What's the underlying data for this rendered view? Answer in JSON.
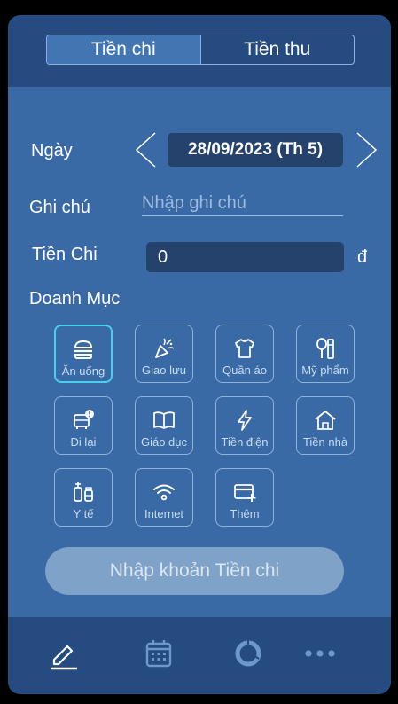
{
  "tabs": [
    {
      "label": "Tiền chi",
      "active": true
    },
    {
      "label": "Tiền thu",
      "active": false
    }
  ],
  "date_label": "Ngày",
  "date_value": "28/09/2023 (Th 5)",
  "note": {
    "label": "Ghi chú",
    "placeholder": "Nhập ghi chú",
    "value": ""
  },
  "amount": {
    "label": "Tiền Chi",
    "value": "0",
    "currency": "đ"
  },
  "category_label": "Doanh Mục",
  "categories": [
    {
      "label": "Ăn uống",
      "icon": "burger-icon",
      "selected": true
    },
    {
      "label": "Giao lưu",
      "icon": "party-popper-icon",
      "selected": false
    },
    {
      "label": "Quần áo",
      "icon": "shirt-icon",
      "selected": false
    },
    {
      "label": "Mỹ phẩm",
      "icon": "cosmetics-icon",
      "selected": false
    },
    {
      "label": "Đi lại",
      "icon": "car-alert-icon",
      "selected": false
    },
    {
      "label": "Giáo dục",
      "icon": "book-icon",
      "selected": false
    },
    {
      "label": "Tiền điện",
      "icon": "lightning-icon",
      "selected": false
    },
    {
      "label": "Tiền nhà",
      "icon": "house-icon",
      "selected": false
    },
    {
      "label": "Y tế",
      "icon": "medicine-icon",
      "selected": false
    },
    {
      "label": "Internet",
      "icon": "wifi-icon",
      "selected": false
    },
    {
      "label": "Thêm",
      "icon": "add-card-icon",
      "selected": false
    }
  ],
  "submit_label": "Nhập khoản Tiền chi",
  "bottom_nav": [
    {
      "icon": "pencil-icon",
      "active": true
    },
    {
      "icon": "calendar-icon",
      "active": false
    },
    {
      "icon": "donut-chart-icon",
      "active": false
    },
    {
      "icon": "more-dots-icon",
      "active": false
    }
  ],
  "colors": {
    "accent_selected": "#47d0f0",
    "background": "#3a6aa5",
    "header": "#254b80"
  }
}
